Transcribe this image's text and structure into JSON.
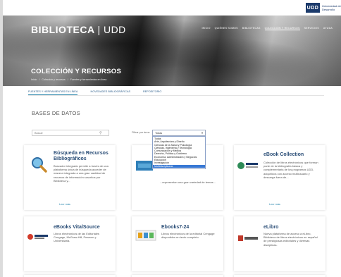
{
  "header": {
    "logo_mark": "UDD",
    "logo_text": "Universidad del Desarrollo",
    "brand_bold": "BIBLIOTECA",
    "brand_thin": "| UDD",
    "nav": [
      "Inicio",
      "Quiénes somos",
      "Bibliotecas",
      "Colección y recursos",
      "Servicios",
      "Ayuda"
    ],
    "nav_active_index": 3,
    "page_title": "COLECCIÓN Y RECURSOS",
    "breadcrumb": [
      "Inicio",
      "/",
      "Colección y recursos",
      "/",
      "Fuentes y herramientas en línea"
    ]
  },
  "tabs": [
    "Fuentes y herramientas en línea",
    "Novedades bibliográficas",
    "Repositorio"
  ],
  "tabs_active_index": 0,
  "section_title": "BASES DE DATOS",
  "filter": {
    "search_placeholder": "Buscar",
    "label": "Filtrar por área:",
    "selected": "Todas",
    "options": [
      "Todas",
      "Arte, Arquitectura y Diseño",
      "Ciencias de la Salud y Psicología",
      "Ciencias, Ingeniería y Tecnología",
      "Comunicación y Medios",
      "Derecho, Política y Gobierno",
      "Economía, Administración y Negocios",
      "Educación",
      "Investigación",
      "Multidisciplinaria"
    ]
  },
  "cards": [
    {
      "title": "Búsqueda en Recursos Bibliográficos",
      "desc": "Buscador integrado permite a través de una plataforma única de búsqueda acceder de manera integrada a una gran cantidad de recursos de información suscritos por Biblioteca y...",
      "link": "Leer más",
      "logo": "magnifier-icon"
    },
    {
      "title": "",
      "desc": "...representan una gran variedad de temas...",
      "link": "",
      "logo": "database-logo"
    },
    {
      "title": "eBook Collection",
      "desc": "Colección de libros electrónicos que forman parte de la bibliografía básica y complementaria de los programas UDD, adquiridos con acceso multiusuario y descarga fuera de...",
      "link": "Leer más",
      "logo": "ebsco-logo"
    },
    {
      "title": "eBooks VitalSource",
      "desc": "Libros electrónicos de las Editoriales Cengage, McGraw-Hill, Pearson y Universitaria.",
      "link": "",
      "logo": "vitalsource-logo"
    },
    {
      "title": "Ebooks7-24",
      "desc": "Libros electrónicos de la editorial Cengage disponibles en texto completo.",
      "link": "",
      "logo": "ebooks724-logo"
    },
    {
      "title": "eLibro",
      "desc": "Nueva plataforma de acceso a eLibro, Biblioteca de libros electrónicos en español de prestigiosas editoriales y diversas disciplinas.",
      "link": "",
      "logo": "elibro-logo"
    }
  ]
}
